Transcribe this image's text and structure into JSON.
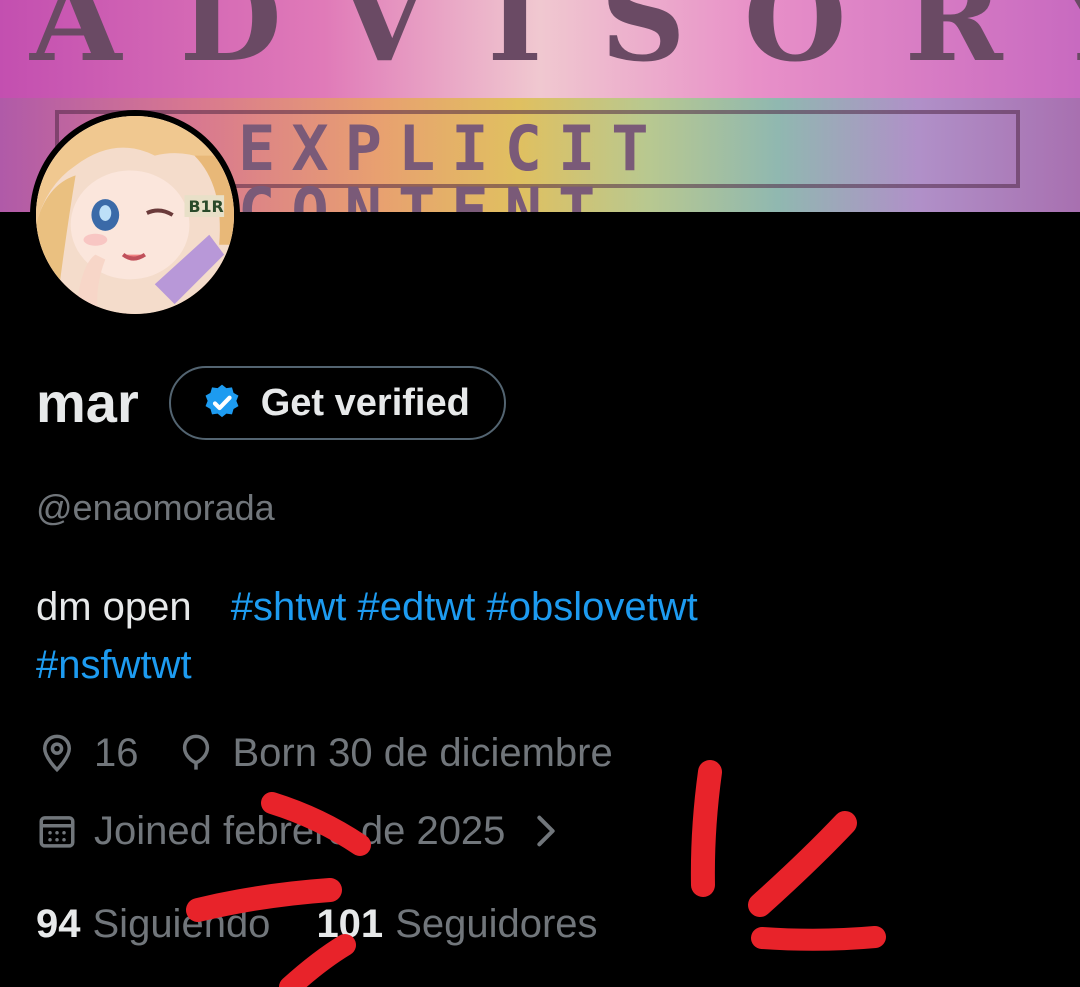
{
  "banner": {
    "headline": "ADVISORY",
    "subline": "EXPLICIT CONTENT"
  },
  "profile": {
    "display_name": "mar",
    "verify_button_label": "Get verified",
    "handle": "@enaomorada",
    "bio": {
      "text": "dm open",
      "hashtags": [
        "#shtwt",
        "#edtwt",
        "#obslovetwt",
        "#nsfwtwt"
      ]
    },
    "location": "16",
    "birthday": "Born 30 de diciembre",
    "joined": "Joined febrero de 2025"
  },
  "stats": {
    "following_count": "94",
    "following_label": "Siguiendo",
    "followers_count": "101",
    "followers_label": "Seguidores"
  },
  "icons": {
    "verify": "verified-badge-icon",
    "location": "location-pin-icon",
    "birthday": "balloon-icon",
    "joined": "calendar-icon",
    "chevron": "chevron-right-icon"
  },
  "colors": {
    "background": "#000000",
    "text_primary": "#e7e9ea",
    "text_secondary": "#71767b",
    "link": "#1d9bf0",
    "scribble": "#e8232a"
  }
}
